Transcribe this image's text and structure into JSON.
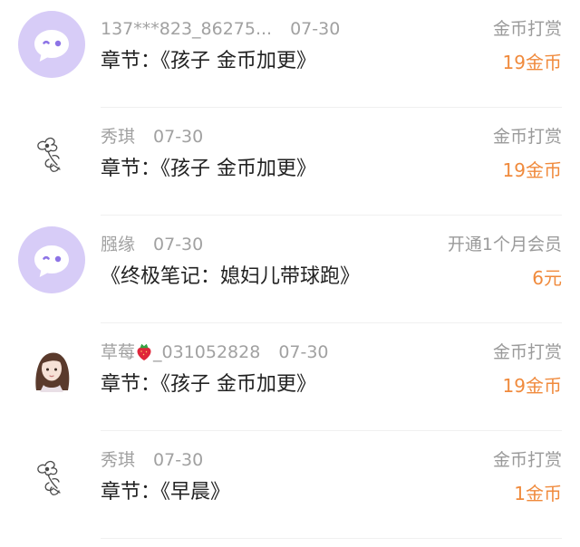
{
  "accent_color": "#f08a3c",
  "records": [
    {
      "avatar": "default-chat-avatar",
      "username": "137***823_86275...",
      "date": "07-30",
      "detail": "章节：《孩子 金币加更》",
      "type": "金币打赏",
      "amount": "19金币"
    },
    {
      "avatar": "flower-sketch-avatar",
      "username": "秀琪",
      "date": "07-30",
      "detail": "章节：《孩子 金币加更》",
      "type": "金币打赏",
      "amount": "19金币"
    },
    {
      "avatar": "default-chat-avatar",
      "username": "膙缘",
      "date": "07-30",
      "detail": "《终极笔记：媳妇儿带球跑》",
      "type": "开通1个月会员",
      "amount": "6元"
    },
    {
      "avatar": "girl-portrait-avatar",
      "username": "草莓",
      "username_emoji": "strawberry",
      "username_suffix": "_031052828",
      "date": "07-30",
      "detail": "章节：《孩子 金币加更》",
      "type": "金币打赏",
      "amount": "19金币"
    },
    {
      "avatar": "flower-sketch-avatar",
      "username": "秀琪",
      "date": "07-30",
      "detail": "章节：《早晨》",
      "type": "金币打赏",
      "amount": "1金币"
    }
  ]
}
